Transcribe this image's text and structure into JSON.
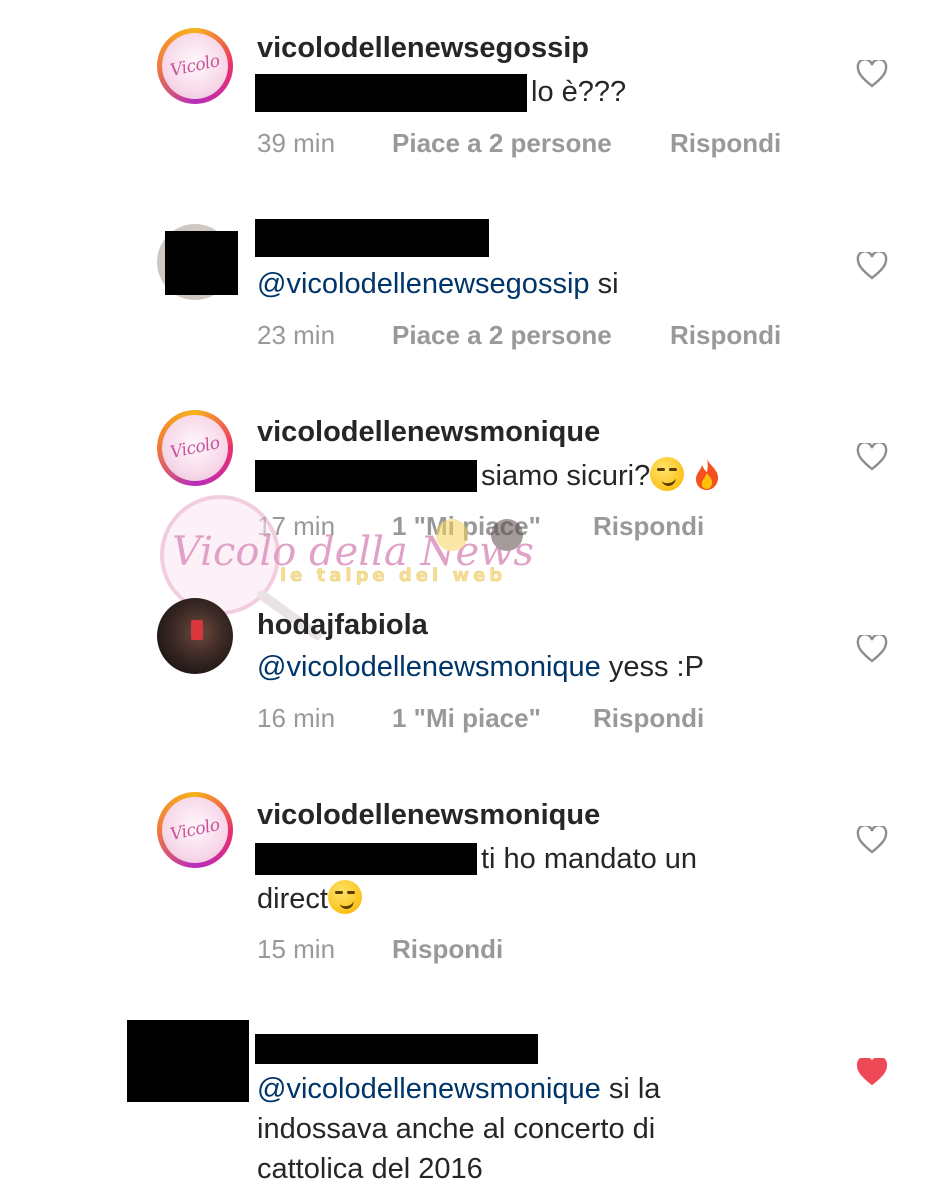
{
  "comments": [
    {
      "username": "vicolodellenewsegossip",
      "text": "lo è???",
      "time": "39 min",
      "likes": "Piace a 2 persone",
      "reply": "Rispondi",
      "avatar_text": "Vicolo"
    },
    {
      "mention": "@vicolodellenewsegossip",
      "text": "si",
      "time": "23 min",
      "likes": "Piace a 2 persone",
      "reply": "Rispondi"
    },
    {
      "username": "vicolodellenewsmonique",
      "text": "siamo sicuri?",
      "time": "17 min",
      "likes": "1 \"Mi piace\"",
      "reply": "Rispondi",
      "avatar_text": "Vicolo"
    },
    {
      "username": "hodajfabiola",
      "mention": "@vicolodellenewsmonique",
      "text": "yess :P",
      "time": "16 min",
      "likes": "1 \"Mi piace\"",
      "reply": "Rispondi"
    },
    {
      "username": "vicolodellenewsmonique",
      "text_line1": "ti ho mandato un",
      "text_line2": "direct",
      "time": "15 min",
      "reply": "Rispondi",
      "avatar_text": "Vicolo"
    },
    {
      "mention": "@vicolodellenewsmonique",
      "text_line1": "si la",
      "text_line2": "indossava anche al concerto di",
      "text_line3": "cattolica del 2016",
      "liked": true
    }
  ],
  "watermark": {
    "brand": "Vicolo della News",
    "tagline": "le talpe del web"
  },
  "colors": {
    "text": "#262626",
    "mention": "#003569",
    "meta": "#999999",
    "heart_liked": "#ed4956",
    "heart_outline": "#8e8e8e"
  },
  "icons": {
    "like": "heart-outline-icon",
    "liked": "heart-filled-icon",
    "emoji_smirk": "smirk-emoji",
    "emoji_fire": "fire-emoji"
  }
}
